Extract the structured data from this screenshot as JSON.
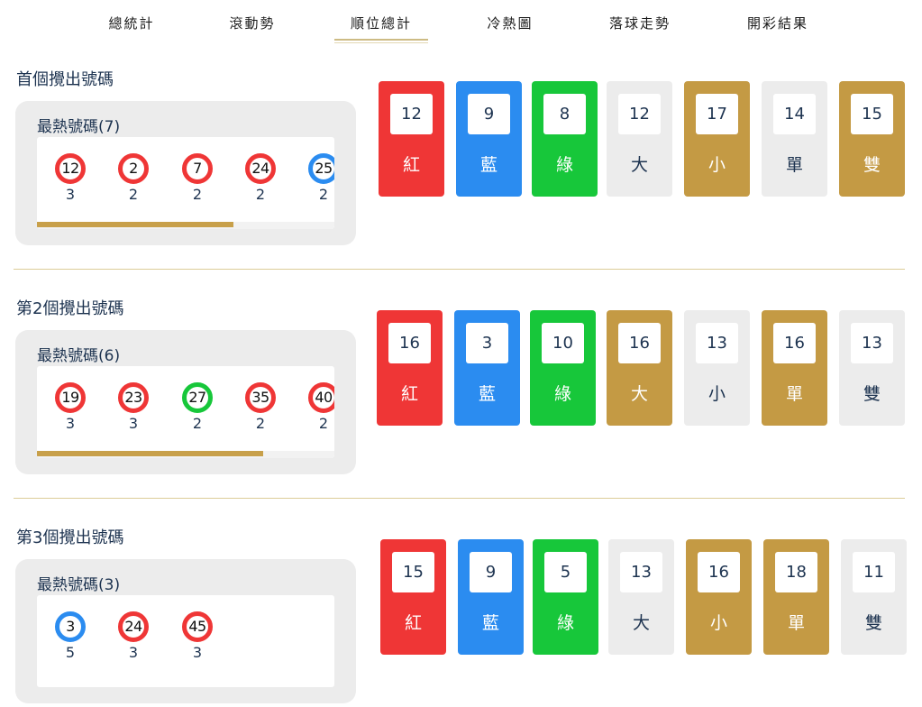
{
  "nav": {
    "tabs": [
      {
        "label": "總統計",
        "active": false
      },
      {
        "label": "滾動勢",
        "active": false
      },
      {
        "label": "順位總計",
        "active": true
      },
      {
        "label": "冷熱圖",
        "active": false
      },
      {
        "label": "落球走勢",
        "active": false
      },
      {
        "label": "開彩結果",
        "active": false
      }
    ]
  },
  "colors": {
    "red": "#ef3636",
    "blue": "#2b8cf0",
    "green": "#17c73a",
    "gold": "#c49a44",
    "grey": "#ececec",
    "navy": "#1d3350",
    "progress": "#c8a04a"
  },
  "sections": [
    {
      "title": "首個攪出號碼",
      "hot_label": "最熱號碼(7)",
      "progress": 0.66,
      "balls": [
        {
          "number": "12",
          "color": "red",
          "count": "3"
        },
        {
          "number": "2",
          "color": "red",
          "count": "2"
        },
        {
          "number": "7",
          "color": "red",
          "count": "2"
        },
        {
          "number": "24",
          "color": "red",
          "count": "2"
        },
        {
          "number": "25",
          "color": "blue",
          "count": "2"
        }
      ],
      "stats": [
        {
          "value": "12",
          "label": "紅",
          "style": "red"
        },
        {
          "value": "9",
          "label": "藍",
          "style": "blue"
        },
        {
          "value": "8",
          "label": "綠",
          "style": "green"
        },
        {
          "value": "12",
          "label": "大",
          "style": "grey"
        },
        {
          "value": "17",
          "label": "小",
          "style": "gold"
        },
        {
          "value": "14",
          "label": "單",
          "style": "grey"
        },
        {
          "value": "15",
          "label": "雙",
          "style": "gold"
        }
      ]
    },
    {
      "title": "第2個攪出號碼",
      "hot_label": "最熱號碼(6)",
      "progress": 0.76,
      "balls": [
        {
          "number": "19",
          "color": "red",
          "count": "3"
        },
        {
          "number": "23",
          "color": "red",
          "count": "3"
        },
        {
          "number": "27",
          "color": "green",
          "count": "2"
        },
        {
          "number": "35",
          "color": "red",
          "count": "2"
        },
        {
          "number": "40",
          "color": "red",
          "count": "2"
        }
      ],
      "stats": [
        {
          "value": "16",
          "label": "紅",
          "style": "red"
        },
        {
          "value": "3",
          "label": "藍",
          "style": "blue"
        },
        {
          "value": "10",
          "label": "綠",
          "style": "green"
        },
        {
          "value": "16",
          "label": "大",
          "style": "gold"
        },
        {
          "value": "13",
          "label": "小",
          "style": "grey"
        },
        {
          "value": "16",
          "label": "單",
          "style": "gold"
        },
        {
          "value": "13",
          "label": "雙",
          "style": "grey"
        }
      ]
    },
    {
      "title": "第3個攪出號碼",
      "hot_label": "最熱號碼(3)",
      "progress": 0,
      "balls": [
        {
          "number": "3",
          "color": "blue",
          "count": "5"
        },
        {
          "number": "24",
          "color": "red",
          "count": "3"
        },
        {
          "number": "45",
          "color": "red",
          "count": "3"
        }
      ],
      "stats": [
        {
          "value": "15",
          "label": "紅",
          "style": "red"
        },
        {
          "value": "9",
          "label": "藍",
          "style": "blue"
        },
        {
          "value": "5",
          "label": "綠",
          "style": "green"
        },
        {
          "value": "13",
          "label": "大",
          "style": "grey"
        },
        {
          "value": "16",
          "label": "小",
          "style": "gold"
        },
        {
          "value": "18",
          "label": "單",
          "style": "gold"
        },
        {
          "value": "11",
          "label": "雙",
          "style": "grey"
        }
      ]
    }
  ]
}
